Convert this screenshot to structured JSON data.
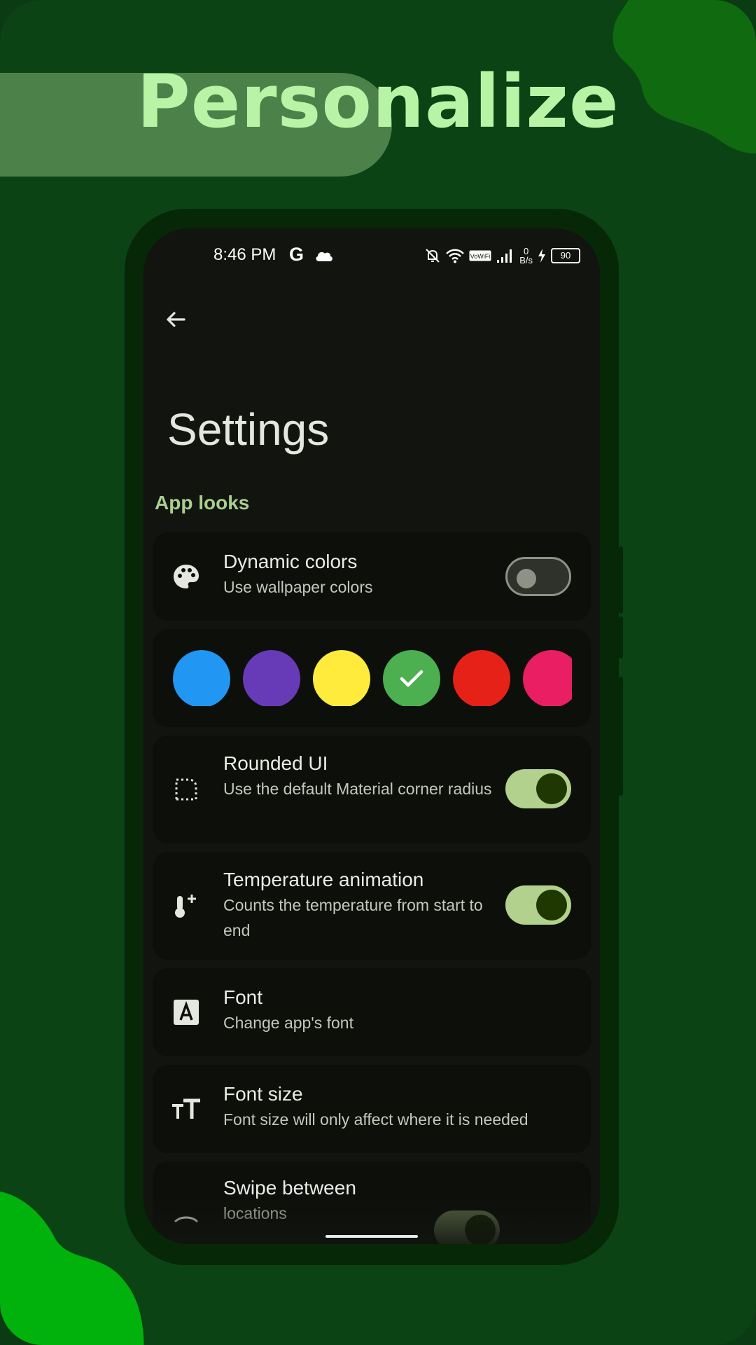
{
  "headline": "Personalize",
  "colors": {
    "background": "#0c4314",
    "banner": "#4c8249",
    "headline": "#b9f4a6",
    "accent": "#a9cf8e",
    "toggle_on": "#b1d18c"
  },
  "status_bar": {
    "time": "8:46 PM",
    "carrier_icon": "G",
    "volte": "VoWiFi",
    "net_speed_value": "0",
    "net_speed_unit": "B/s",
    "battery": "90",
    "icons": [
      "cloud-icon",
      "bell-off-icon",
      "wifi-icon",
      "signal-icon",
      "charging-icon"
    ]
  },
  "settings": {
    "title": "Settings",
    "section": "App looks",
    "items": [
      {
        "title": "Dynamic colors",
        "subtitle": "Use wallpaper colors",
        "icon": "palette-icon",
        "toggle": false
      },
      {
        "title": "Rounded UI",
        "subtitle": "Use the default Material corner radius",
        "icon": "rounded-corner-icon",
        "toggle": true
      },
      {
        "title": "Temperature animation",
        "subtitle": "Counts the temperature from start to end",
        "icon": "thermometer-plus-icon",
        "toggle": true
      },
      {
        "title": "Font",
        "subtitle": "Change app's font",
        "icon": "font-icon"
      },
      {
        "title": "Font size",
        "subtitle": "Font size will only affect where it is needed",
        "icon": "font-size-icon"
      },
      {
        "title": "Swipe between",
        "subtitle": "locations",
        "icon": "swipe-icon",
        "toggle": true
      }
    ],
    "color_swatches": [
      {
        "color": "#2196f3",
        "selected": false
      },
      {
        "color": "#673ab7",
        "selected": false
      },
      {
        "color": "#ffeb3b",
        "selected": false
      },
      {
        "color": "#4caf50",
        "selected": true
      },
      {
        "color": "#e62117",
        "selected": false
      },
      {
        "color": "#e91e63",
        "selected": false
      }
    ]
  }
}
